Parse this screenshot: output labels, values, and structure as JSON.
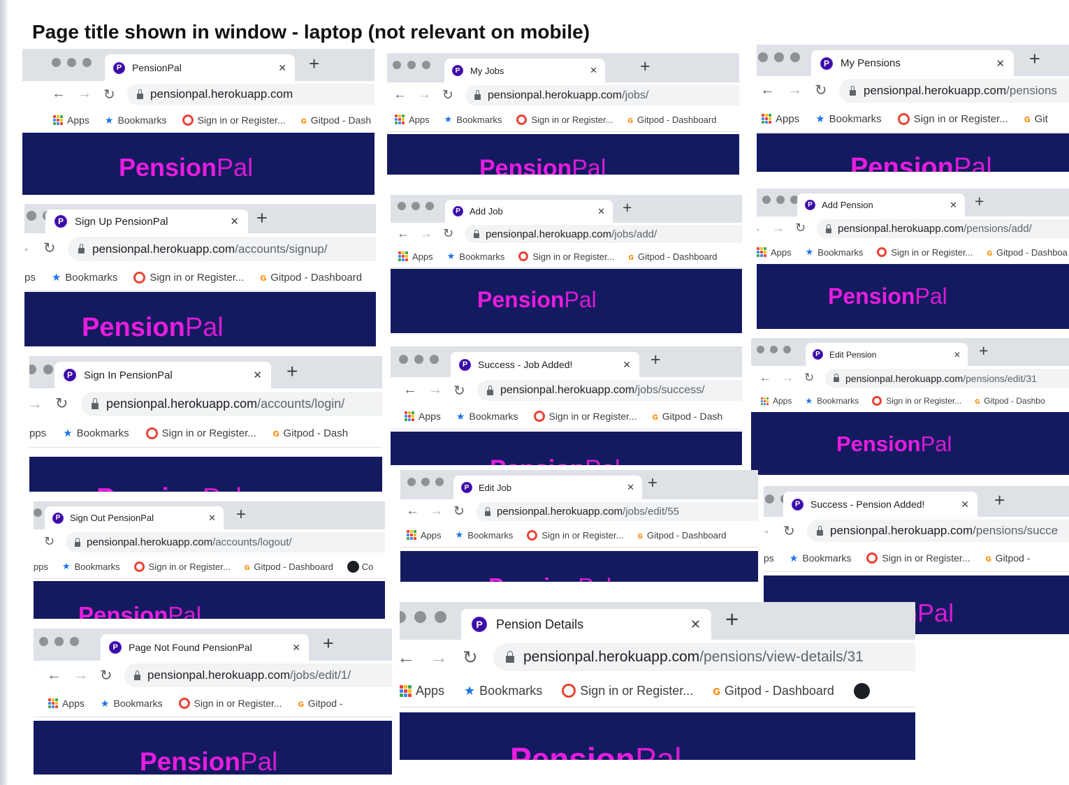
{
  "page_title": "Page title shown in window - laptop (not relevant on mobile)",
  "common": {
    "bookmarks": {
      "apps": "Apps",
      "bookmarks": "Bookmarks",
      "sign_in": "Sign in or Register...",
      "gitpod": "Gitpod - Dashboard",
      "gitpod_short": "Gitpod - Dash",
      "gitpod_trunc": "Gitpod - Dashboa",
      "gitpod_trunc2": "Gitpod - Dashbo",
      "gitpod_trunc3": "Gitpod -",
      "gitpod_git": "Git",
      "apps_clip": "pps",
      "apps_clip2": "ps",
      "cut": "Co"
    },
    "logo_bold": "Pension",
    "logo_light": "Pal",
    "favicon_letter": "P",
    "brand_color": "#141a60",
    "accent_color": "#e81ddf"
  },
  "screens": [
    {
      "tab": "PensionPal",
      "host": "pensionpal.herokuapp.com",
      "path": ""
    },
    {
      "tab": "My Jobs",
      "host": "pensionpal.herokuapp.com",
      "path": "/jobs/"
    },
    {
      "tab": "My Pensions",
      "host": "pensionpal.herokuapp.com",
      "path": "/pensions"
    },
    {
      "tab": "Sign Up PensionPal",
      "host": "pensionpal.herokuapp.com",
      "path": "/accounts/signup/"
    },
    {
      "tab": "Add Job",
      "host": "pensionpal.herokuapp.com",
      "path": "/jobs/add/"
    },
    {
      "tab": "Add Pension",
      "host": "pensionpal.herokuapp.com",
      "path": "/pensions/add/"
    },
    {
      "tab": "Sign In PensionPal",
      "host": "pensionpal.herokuapp.com",
      "path": "/accounts/login/"
    },
    {
      "tab": "Success - Job Added!",
      "host": "pensionpal.herokuapp.com",
      "path": "/jobs/success/"
    },
    {
      "tab": "Edit Pension",
      "host": "pensionpal.herokuapp.com",
      "path": "/pensions/edit/31"
    },
    {
      "tab": "Sign Out PensionPal",
      "host": "pensionpal.herokuapp.com",
      "path": "/accounts/logout/"
    },
    {
      "tab": "Edit Job",
      "host": "pensionpal.herokuapp.com",
      "path": "/jobs/edit/55"
    },
    {
      "tab": "Success - Pension Added!",
      "host": "pensionpal.herokuapp.com",
      "path": "/pensions/succe"
    },
    {
      "tab": "Page Not Found PensionPal",
      "host": "pensionpal.herokuapp.com",
      "path": "/jobs/edit/1/"
    },
    {
      "tab": "Pension Details",
      "host": "pensionpal.herokuapp.com",
      "path": "/pensions/view-details/31"
    }
  ]
}
